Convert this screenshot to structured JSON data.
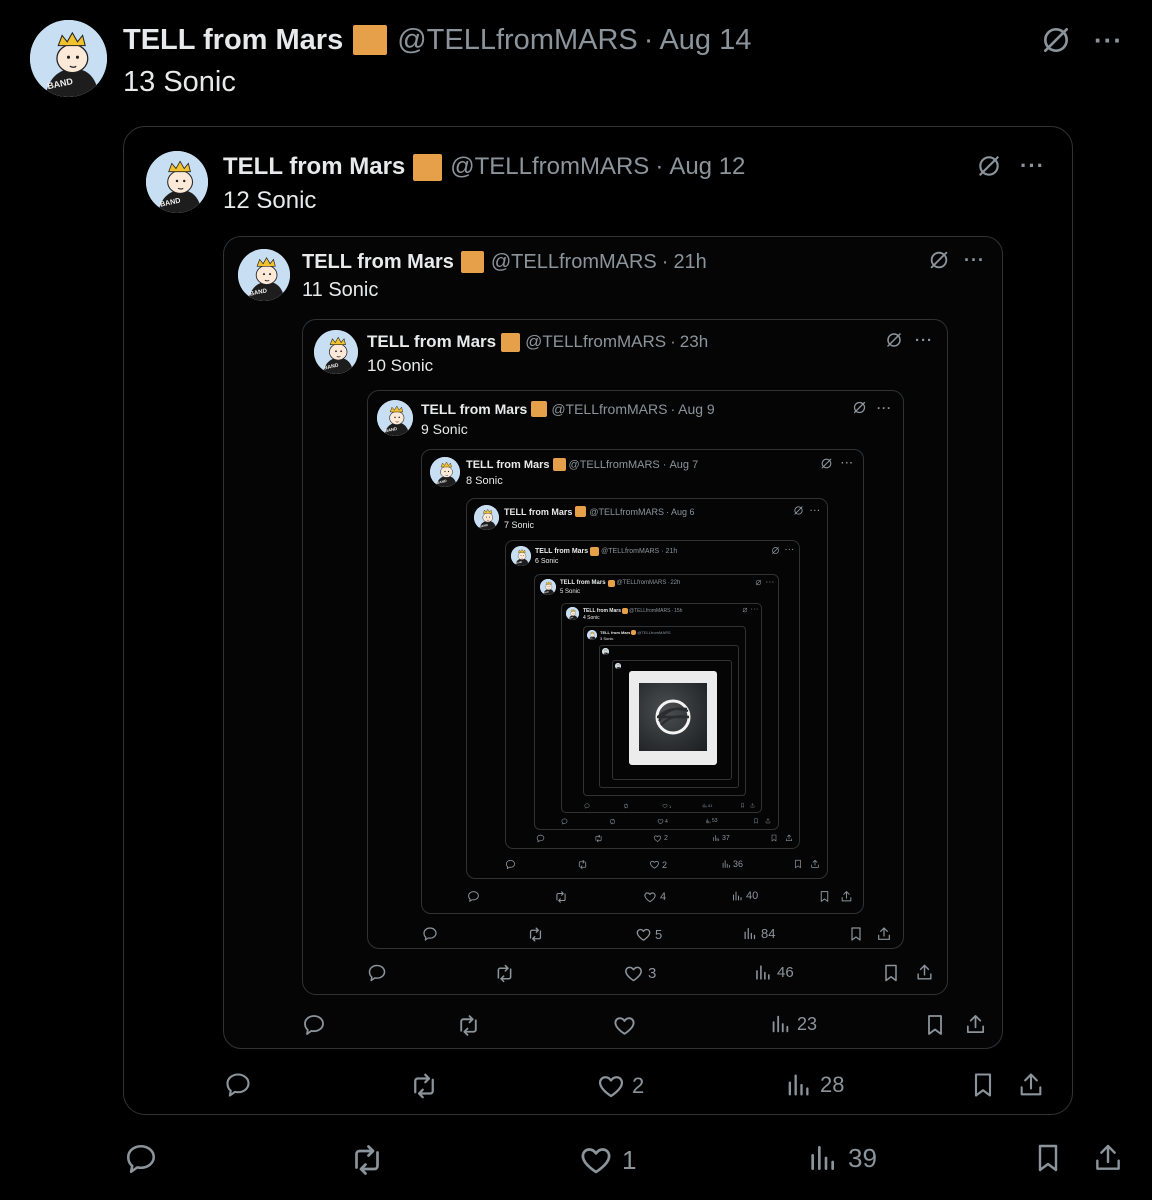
{
  "tweets": [
    {
      "name": "TELL from Mars",
      "handle": "@TELLfromMARS",
      "time": "Aug 14",
      "text": "13 Sonic",
      "replies": "",
      "retweets": "",
      "likes": "1",
      "views": "39"
    },
    {
      "name": "TELL from Mars",
      "handle": "@TELLfromMARS",
      "time": "Aug 12",
      "text": "12 Sonic",
      "likes": "2",
      "views": "28"
    },
    {
      "name": "TELL from Mars",
      "handle": "@TELLfromMARS",
      "time": "21h",
      "text": "11 Sonic",
      "likes": "",
      "views": "23"
    },
    {
      "name": "TELL from Mars",
      "handle": "@TELLfromMARS",
      "time": "23h",
      "text": "10 Sonic",
      "likes": "3",
      "views": "46"
    },
    {
      "name": "TELL from Mars",
      "handle": "@TELLfromMARS",
      "time": "Aug 9",
      "text": "9 Sonic",
      "likes": "5",
      "views": "84"
    },
    {
      "name": "TELL from Mars",
      "handle": "@TELLfromMARS",
      "time": "Aug 7",
      "text": "8 Sonic",
      "likes": "4",
      "views": "40"
    },
    {
      "name": "TELL from Mars",
      "handle": "@TELLfromMARS",
      "time": "Aug 6",
      "text": "7 Sonic",
      "likes": "2",
      "views": "36"
    },
    {
      "name": "TELL from Mars",
      "handle": "@TELLfromMARS",
      "time": "21h",
      "text": "6 Sonic",
      "likes": "2",
      "views": "37"
    },
    {
      "name": "TELL from Mars",
      "handle": "@TELLfromMARS",
      "time": "22h",
      "text": "5 Sonic",
      "likes": "4",
      "views": "53"
    },
    {
      "name": "TELL from Mars",
      "handle": "@TELLfromMARS",
      "time": "15h",
      "text": "4 Sonic",
      "likes": "1",
      "views": "41"
    },
    {
      "name": "TELL from Mars",
      "handle": "@TELLfromMARS",
      "time": "18h",
      "text": "3 Sonic"
    }
  ],
  "dot": "·",
  "more": "···",
  "colors": {
    "background": "#000000",
    "text": "#e7e9ea",
    "muted": "#8b949b",
    "badge": "#e6a04a",
    "border": "#2f3336"
  },
  "icons": {
    "grok": "slashed-circle-icon",
    "more": "more-icon",
    "reply": "reply-icon",
    "retweet": "retweet-icon",
    "like": "heart-icon",
    "views": "views-icon",
    "bookmark": "bookmark-icon",
    "share": "share-icon"
  }
}
